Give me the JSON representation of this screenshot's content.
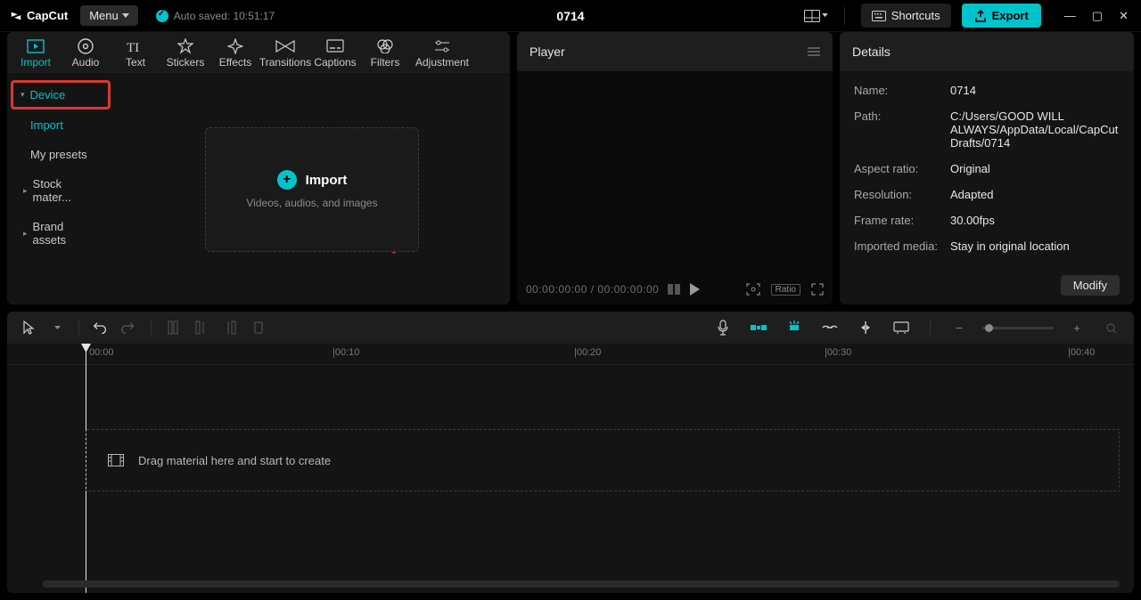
{
  "app": {
    "name": "CapCut",
    "menu_label": "Menu",
    "auto_save_text": "Auto saved: 10:51:17",
    "project_title": "0714",
    "shortcuts_label": "Shortcuts",
    "export_label": "Export"
  },
  "tabs": {
    "import": "Import",
    "audio": "Audio",
    "text": "Text",
    "stickers": "Stickers",
    "effects": "Effects",
    "transitions": "Transitions",
    "captions": "Captions",
    "filters": "Filters",
    "adjustment": "Adjustment"
  },
  "sidebar": {
    "device": "Device",
    "import": "Import",
    "my_presets": "My presets",
    "stock_materials": "Stock mater...",
    "brand_assets": "Brand assets"
  },
  "import_box": {
    "title": "Import",
    "subtitle": "Videos, audios, and images"
  },
  "player": {
    "title": "Player",
    "time_current": "00:00:00:00",
    "time_total": "00:00:00:00",
    "ratio_label": "Ratio"
  },
  "details": {
    "title": "Details",
    "name_label": "Name:",
    "name_value": "0714",
    "path_label": "Path:",
    "path_value": "C:/Users/GOOD WILL ALWAYS/AppData/Local/CapCut Drafts/0714",
    "aspect_label": "Aspect ratio:",
    "aspect_value": "Original",
    "resolution_label": "Resolution:",
    "resolution_value": "Adapted",
    "framerate_label": "Frame rate:",
    "framerate_value": "30.00fps",
    "imported_label": "Imported media:",
    "imported_value": "Stay in original location",
    "modify_label": "Modify"
  },
  "timeline": {
    "ticks": [
      "00:00",
      "|00:10",
      "|00:20",
      "|00:30",
      "|00:40"
    ],
    "drop_hint": "Drag material here and start to create"
  }
}
